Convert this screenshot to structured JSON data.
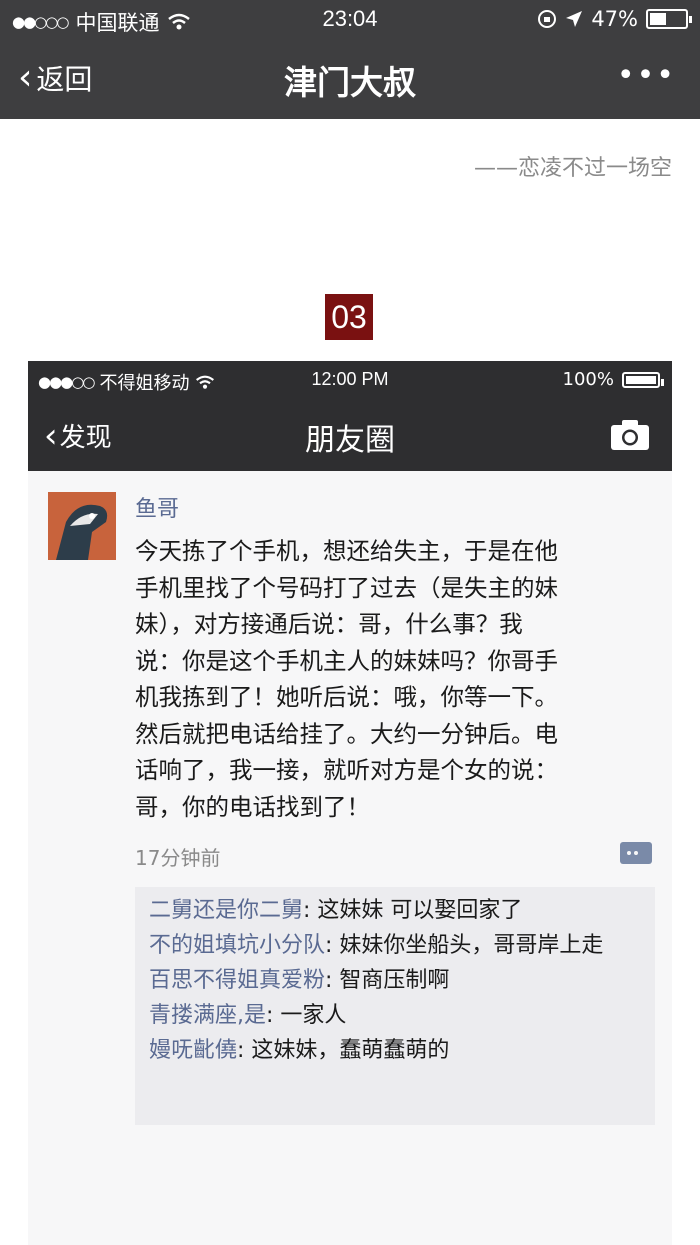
{
  "outer": {
    "status": {
      "carrier": "中国联通",
      "time": "23:04",
      "battery": "47%",
      "battery_level": 0.47
    },
    "nav": {
      "back_label": "返回",
      "title": "津门大叔",
      "more_label": "•••"
    }
  },
  "quote": "——恋凌不过一场空",
  "section_number": "03",
  "inner": {
    "status": {
      "carrier": "不得姐移动",
      "time": "12:00 PM",
      "battery": "100%",
      "battery_level": 1.0
    },
    "nav": {
      "back_label": "发现",
      "title": "朋友圈"
    },
    "post": {
      "author": "鱼哥",
      "lines": [
        "今天拣了个手机，想还给失主，于是在他",
        "手机里找了个号码打了过去（是失主的妹",
        "妹），对方接通后说：哥，什么事？我",
        "说：你是这个手机主人的妹妹吗？你哥手",
        "机我拣到了！她听后说：哦，你等一下。",
        "然后就把电话给挂了。大约一分钟后。电",
        "话响了，我一接，就听对方是个女的说：",
        "哥，你的电话找到了！"
      ],
      "time": "17分钟前"
    },
    "comments": [
      {
        "who": "二舅还是你二舅",
        "text": ": 这妹妹 可以娶回家了"
      },
      {
        "who": "不的姐填坑小分队",
        "text": ": 妹妹你坐船头，哥哥岸上走"
      },
      {
        "who": "百思不得姐真爱粉",
        "text": ": 智商压制啊"
      },
      {
        "who": "青搂满座,是",
        "text": ": 一家人"
      },
      {
        "who": "嫚呒齔僥",
        "text": ": 这妹妹，蠢萌蠢萌的"
      }
    ]
  }
}
